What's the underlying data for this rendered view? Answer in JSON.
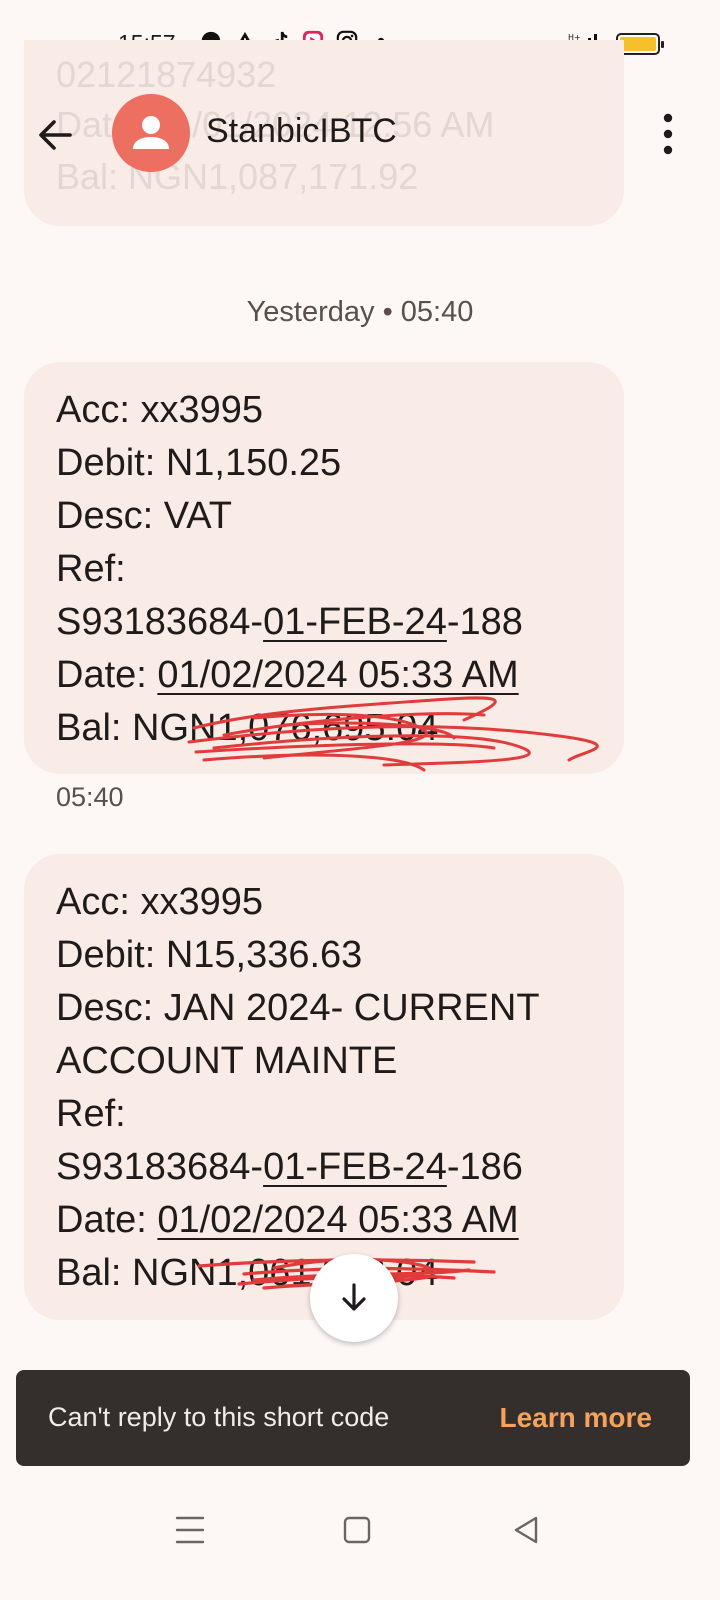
{
  "status_bar": {
    "time": "15:57",
    "icons": [
      "messenger-icon",
      "alert-icon",
      "tiktok-icon",
      "video-app-icon",
      "instagram-icon",
      "dot-icon"
    ],
    "signal": "signal-icon",
    "battery_color": "#f5c02a"
  },
  "previous_message": {
    "line1": "02121874932",
    "line2": "Date: 31/01/2024 12:56 AM",
    "line3": "Bal: NGN1,087,171.92"
  },
  "header": {
    "contact_name": "StanbicIBTC",
    "avatar_color": "#ec6f61"
  },
  "date_divider": "Yesterday • 05:40",
  "messages": [
    {
      "acc": "Acc: xx3995",
      "debit": "Debit: N1,150.25",
      "desc": "Desc: VAT",
      "ref_label": "Ref:",
      "ref_prefix": "S93183684-",
      "ref_date": "01-FEB-24",
      "ref_suffix": "-188",
      "date_label": "Date: ",
      "date_value": "01/02/2024 05:33 AM",
      "bal": "Bal: NGN1,076,695.04",
      "time": "05:40"
    },
    {
      "acc": "Acc: xx3995",
      "debit": "Debit: N15,336.63",
      "desc1": "Desc: JAN 2024- CURRENT",
      "desc2": "ACCOUNT MAINTE",
      "ref_label": "Ref:",
      "ref_prefix": "S93183684-",
      "ref_date": "01-FEB-24",
      "ref_suffix": "-186",
      "date_label": "Date: ",
      "date_value": "01/02/2024 05:33 AM",
      "bal": "Bal: NGN1,061,358.04"
    }
  ],
  "snackbar": {
    "text": "Can't reply to this short code",
    "action": "Learn more"
  },
  "colors": {
    "background": "#fdf8f6",
    "bubble": "#f9ebe6",
    "accent": "#f5a35c",
    "scribble": "#e23b3b"
  }
}
